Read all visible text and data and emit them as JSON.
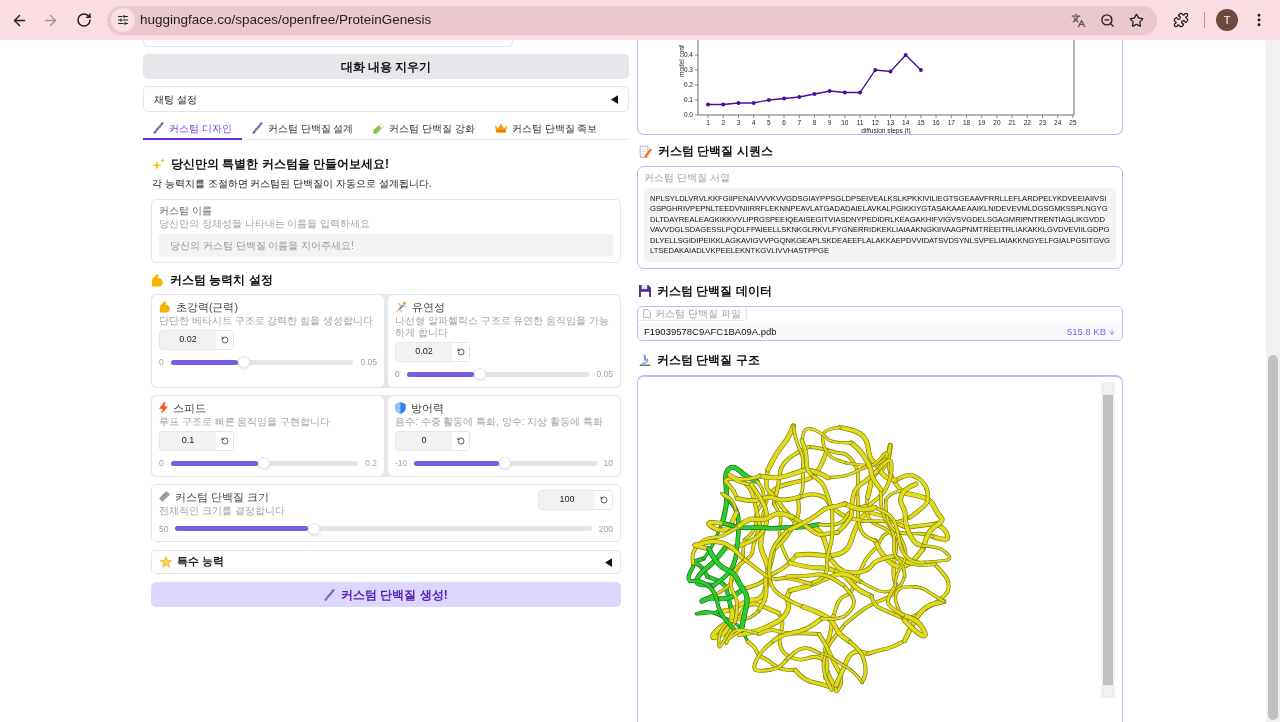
{
  "browser": {
    "url": "huggingface.co/spaces/openfree/ProteinGenesis",
    "forward_disabled": true,
    "profile_initial": "T"
  },
  "left": {
    "clear_button": "대화 내용 지우기",
    "chat_settings": {
      "label": "채팅 설정",
      "expanded": false
    },
    "tabs": [
      {
        "label": "커스텀 디자인",
        "selected": true
      },
      {
        "label": "커스텀 단백질 설계",
        "selected": false
      },
      {
        "label": "커스텀 단백질 강화",
        "selected": false
      },
      {
        "label": "커스텀 단백질 족보",
        "selected": false
      }
    ],
    "intro_title": "당신만의 특별한 커스텀을 만들어보세요!",
    "intro_text": "각 능력치를 조절하면 커스텀된 단백질이 자동으로 설계됩니다.",
    "name_field": {
      "label": "커스텀 이름",
      "info": "당신만의 정체성을 나타내는 이름을 입력하세요",
      "placeholder": "당신의 커스텀 단백질 이름을 지어주세요!"
    },
    "stats_title": "커스텀 능력치 설정",
    "stats": [
      {
        "label": "초강력(근력)",
        "info": "단단한 베타시트 구조로 강력한 힘을 생성합니다",
        "value": "0.02",
        "min": "0",
        "max": "0.05",
        "level": 0.4
      },
      {
        "label": "유연성",
        "info": "나선형 알파헬릭스 구조로 유연한 움직임을 가능하게 합니다",
        "value": "0.02",
        "min": "0",
        "max": "0.05",
        "level": 0.4
      },
      {
        "label": "스피드",
        "info": "루프 구조로 빠른 움직임을 구현합니다",
        "value": "0.1",
        "min": "0",
        "max": "0.2",
        "level": 0.5
      },
      {
        "label": "방어력",
        "info": "음수: 수중 활동에 특화, 양수: 지상 활동에 특화",
        "value": "0",
        "min": "-10",
        "max": "10",
        "level": 0.5
      }
    ],
    "size": {
      "label": "커스텀 단백질 크기",
      "info": "전체적인 크기를 결정합니다",
      "value": "100",
      "min": "50",
      "max": "200",
      "level": 0.333
    },
    "special": {
      "label": "특수 능력",
      "expanded": false
    },
    "generate_button": "커스텀 단백질 생성!"
  },
  "right": {
    "chart": {
      "chart_data": {
        "type": "line",
        "xlabel": "diffusion steps (t)",
        "ylabel": "model conf",
        "x": [
          1,
          2,
          3,
          4,
          5,
          6,
          7,
          8,
          9,
          10,
          11,
          12,
          13,
          14,
          15
        ],
        "values": [
          0.07,
          0.07,
          0.08,
          0.08,
          0.1,
          0.11,
          0.12,
          0.14,
          0.16,
          0.15,
          0.15,
          0.3,
          0.29,
          0.4,
          0.3
        ],
        "color": "#4a0e9e",
        "xlim": [
          0.34,
          25.07
        ],
        "ylim": [
          0,
          0.5
        ],
        "xticks": [
          1,
          2,
          3,
          4,
          5,
          6,
          7,
          8,
          9,
          10,
          11,
          12,
          13,
          14,
          15,
          16,
          17,
          18,
          19,
          20,
          21,
          22,
          23,
          24,
          25
        ],
        "yticks": [
          {
            "value": 0,
            "label": "0.0"
          },
          0.1,
          0.2,
          0.3,
          0.4
        ]
      }
    },
    "sequence": {
      "heading": "커스텀 단백질 시퀀스",
      "label": "커스텀 단백질 서열",
      "value": "NPLSYLDLVRVLKKFGIIPENAIVVVKVVGDSGIAYPPSGLDPSEIVEALKSLKPKKIVILIEGTSGEAAVFRRLLEFLARDPELYKDVEEIAIIVSIGSPGHRIVPEPNLTEEDVNIIRRFLEKNNPEAVLATGADADAIELAVKALPGIKKIYGTASAKAAEAAIKLNIDEVEVMLDGSGMKSSPLNGYGDLTDAYREALEAGKIKKVVLIPRGSPEEIQEAISEGITVIASDNYPEDIDRLKEAGAKHIFVIGVSVGDELSGAGMRIPNTRENTIAGLIKGVDDVAVVDGLSDAGESSLPQDLFPAIEELLSKNKGLRKVLFYGNERRIDKEKLIAIAAKNGKIIVAAGPNMTREEITRLIAKAKKLGVDVEVIILGDPGDLYELLSGIDIPEIKKLAGKAVIGVVPGQNKGEAPLSKDEAEEFLALAKKAEPDVVIDATSVDSYNLSVPELIAIAKKNGYELFGIALPGSITGVGLTSEDAKAIADLVKPEELEKNTKGVLIVVHASTPPGE"
    },
    "data": {
      "heading": "커스텀 단백질 데이터",
      "label": "커스텀 단백질 파일",
      "file_name": "F19039578C9AFC1BA09A.pdb",
      "file_size": "515.8 KB"
    },
    "structure": {
      "heading": "커스텀 단백질 구조"
    }
  }
}
